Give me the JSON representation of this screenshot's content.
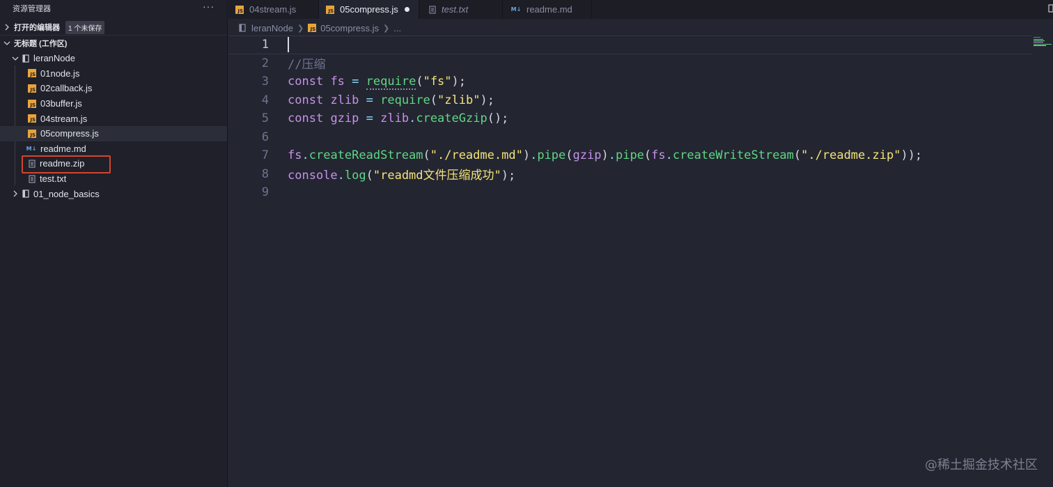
{
  "sidebar": {
    "title": "资源管理器",
    "more": "···",
    "open_editors": {
      "label": "打开的编辑器",
      "badge": "1 个未保存"
    },
    "workspace": {
      "label": "无标题 (工作区)"
    },
    "root_folder": "leranNode",
    "files": [
      {
        "name": "01node.js",
        "type": "js"
      },
      {
        "name": "02callback.js",
        "type": "js"
      },
      {
        "name": "03buffer.js",
        "type": "js"
      },
      {
        "name": "04stream.js",
        "type": "js"
      },
      {
        "name": "05compress.js",
        "type": "js",
        "active": true
      },
      {
        "name": "readme.md",
        "type": "md"
      },
      {
        "name": "readme.zip",
        "type": "file"
      },
      {
        "name": "test.txt",
        "type": "file"
      }
    ],
    "collapsed_folder": "01_node_basics"
  },
  "tabs": [
    {
      "label": "04stream.js",
      "type": "js"
    },
    {
      "label": "05compress.js",
      "type": "js",
      "active": true,
      "unsaved": true
    },
    {
      "label": "test.txt",
      "type": "file",
      "italic": true
    },
    {
      "label": "readme.md",
      "type": "md"
    }
  ],
  "breadcrumb": {
    "folder": "leranNode",
    "file": "05compress.js",
    "more": "..."
  },
  "editor": {
    "line_numbers": [
      "1",
      "2",
      "3",
      "4",
      "5",
      "6",
      "7",
      "8",
      "9"
    ],
    "comment": "//压缩",
    "kw_const": "const",
    "fs": "fs",
    "zlib": "zlib",
    "gzip": "gzip",
    "eq": "=",
    "require": "require",
    "str_fs": "\"fs\"",
    "str_zlib": "\"zlib\"",
    "createGzip": "createGzip",
    "createReadStream": "createReadStream",
    "pipe": "pipe",
    "createWriteStream": "createWriteStream",
    "str_readme_md": "\"./readme.md\"",
    "str_readme_zip": "\"./readme.zip\"",
    "console": "console",
    "log": "log",
    "str_msg": "\"readmd文件压缩成功\""
  },
  "watermark": "@稀土掘金技术社区",
  "colors": {
    "highlight": "#d4452f",
    "js_icon": "#e9a43a",
    "md_icon": "#6fa3d8"
  }
}
